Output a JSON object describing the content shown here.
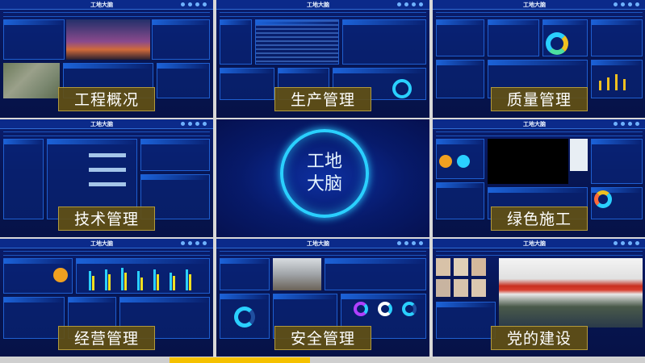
{
  "app_title": "工地大脑",
  "tiles": [
    {
      "id": "overview",
      "label": "工程概况"
    },
    {
      "id": "production",
      "label": "生产管理"
    },
    {
      "id": "quality",
      "label": "质量管理"
    },
    {
      "id": "technology",
      "label": "技术管理"
    },
    {
      "id": "green",
      "label": "绿色施工"
    },
    {
      "id": "business",
      "label": "经营管理"
    },
    {
      "id": "safety",
      "label": "安全管理"
    },
    {
      "id": "party",
      "label": "党的建设"
    }
  ],
  "center": {
    "line1": "工地",
    "line2": "大脑"
  },
  "colors": {
    "panel_bg": "#0a1d6e",
    "frame": "#1f5fd0",
    "label_bg": "#62501a",
    "accent_cyan": "#2ad0ff",
    "accent_yellow": "#f0c020",
    "footer_yellow": "#f5c100"
  }
}
